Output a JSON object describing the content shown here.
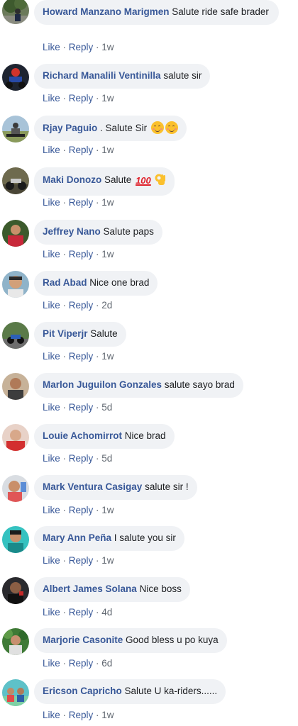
{
  "action_like": "Like",
  "action_reply": "Reply",
  "separator": " · ",
  "comments": [
    {
      "name": "Howard Manzano Marigmen",
      "text": "Salute ride safe brader",
      "time": "1w",
      "avatar_icon": "person-by-tree-avatar"
    },
    {
      "name": "Richard Manalili Ventinilla",
      "text": "salute sir",
      "time": "1w",
      "avatar_icon": "rider-on-motorcycle-avatar"
    },
    {
      "name": "Rjay Paguio",
      "text": ". Salute Sir",
      "emojis": [
        "smiling-face-emoji",
        "smiling-face-emoji"
      ],
      "time": "1w",
      "avatar_icon": "rider-on-field-avatar"
    },
    {
      "name": "Maki Donozo",
      "text": "Salute",
      "emojis": [
        "hundred-points-emoji",
        "ok-hand-emoji"
      ],
      "hundred_text": "100",
      "time": "1w",
      "avatar_icon": "motorcycle-avatar"
    },
    {
      "name": "Jeffrey Nano",
      "text": "Salute paps",
      "time": "1w",
      "avatar_icon": "person-red-shirt-avatar"
    },
    {
      "name": "Rad Abad",
      "text": "Nice one brad",
      "time": "2d",
      "avatar_icon": "person-face-avatar"
    },
    {
      "name": "Pit Viperjr",
      "text": "Salute",
      "time": "1w",
      "avatar_icon": "motorcycle-road-avatar"
    },
    {
      "name": "Marlon Juguilon Gonzales",
      "text": "salute sayo brad",
      "time": "5d",
      "avatar_icon": "person-portrait-avatar"
    },
    {
      "name": "Louie Achomirrot",
      "text": "Nice brad",
      "time": "5d",
      "avatar_icon": "person-red-avatar"
    },
    {
      "name": "Mark Ventura Casigay",
      "text": "salute sir !",
      "time": "1w",
      "avatar_icon": "person-selfie-avatar"
    },
    {
      "name": "Mary Ann Peña",
      "text": "I salute you sir",
      "time": "1w",
      "avatar_icon": "person-teal-avatar"
    },
    {
      "name": "Albert James Solana",
      "text": "Nice boss",
      "time": "4d",
      "avatar_icon": "person-dark-avatar"
    },
    {
      "name": "Marjorie Casonite",
      "text": "Good bless u po kuya",
      "time": "6d",
      "avatar_icon": "person-garden-avatar"
    },
    {
      "name": "Ericson Capricho",
      "text": "Salute U ka-riders......",
      "time": "1w",
      "avatar_icon": "group-photo-avatar"
    }
  ],
  "colors": {
    "name_link": "#385898",
    "bubble_bg": "#f0f2f5",
    "meta_text": "#606770"
  }
}
